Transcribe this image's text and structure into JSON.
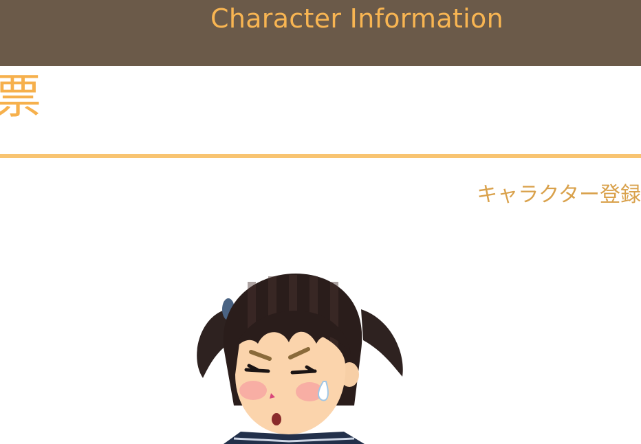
{
  "header": {
    "title": "Character Information"
  },
  "page": {
    "heading_fragment": "票"
  },
  "actions": {
    "register_label": "キャラクター登録"
  },
  "illustration": {
    "subject": "girl-in-sailor-uniform-illustration"
  },
  "colors": {
    "header_bg": "#6b5a49",
    "accent": "#f8b552",
    "rule": "#f8c471",
    "link": "#d9a14b"
  }
}
